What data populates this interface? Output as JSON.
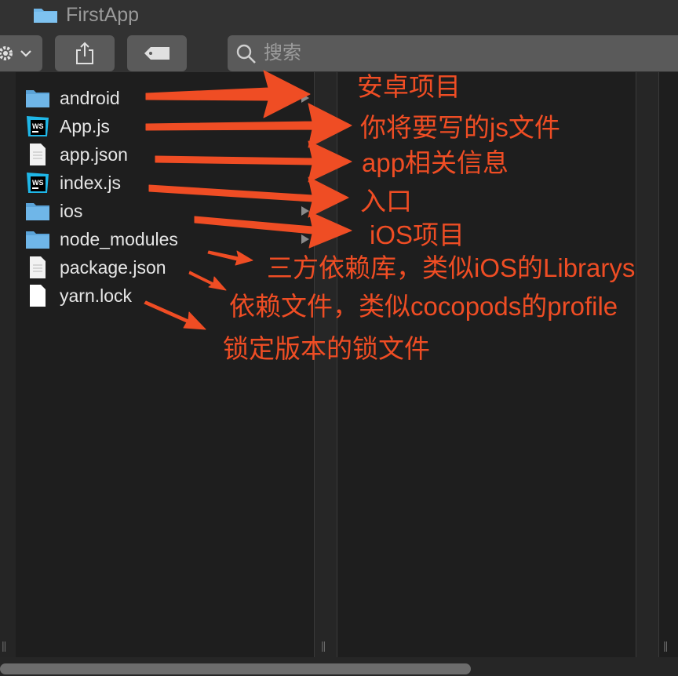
{
  "window": {
    "title": "FirstApp"
  },
  "toolbar": {
    "search_placeholder": "搜索"
  },
  "files": [
    {
      "name": "android",
      "type": "folder",
      "has_children": true
    },
    {
      "name": "App.js",
      "type": "webstorm-js",
      "has_children": false
    },
    {
      "name": "app.json",
      "type": "document",
      "has_children": false
    },
    {
      "name": "index.js",
      "type": "webstorm-js",
      "has_children": false
    },
    {
      "name": "ios",
      "type": "folder",
      "has_children": true
    },
    {
      "name": "node_modules",
      "type": "folder",
      "has_children": true
    },
    {
      "name": "package.json",
      "type": "document",
      "has_children": false
    },
    {
      "name": "yarn.lock",
      "type": "document-white",
      "has_children": false
    }
  ],
  "annotations": {
    "android": "安卓项目",
    "app_js": "你将要写的js文件",
    "app_json": "app相关信息",
    "index_js": "入口",
    "ios": "iOS项目",
    "node_modules": "三方依赖库，类似iOS的Librarys",
    "package_json": "依赖文件，类似cocopods的profile",
    "yarn_lock": "锁定版本的锁文件"
  },
  "colors": {
    "annotation": "#ef4d24",
    "folder": "#6fb6e8",
    "background": "#1e1e1e",
    "toolbar": "#323232"
  },
  "icons": [
    "folder-icon",
    "gear-icon",
    "share-icon",
    "tag-icon",
    "search-icon",
    "webstorm-icon",
    "document-icon"
  ]
}
